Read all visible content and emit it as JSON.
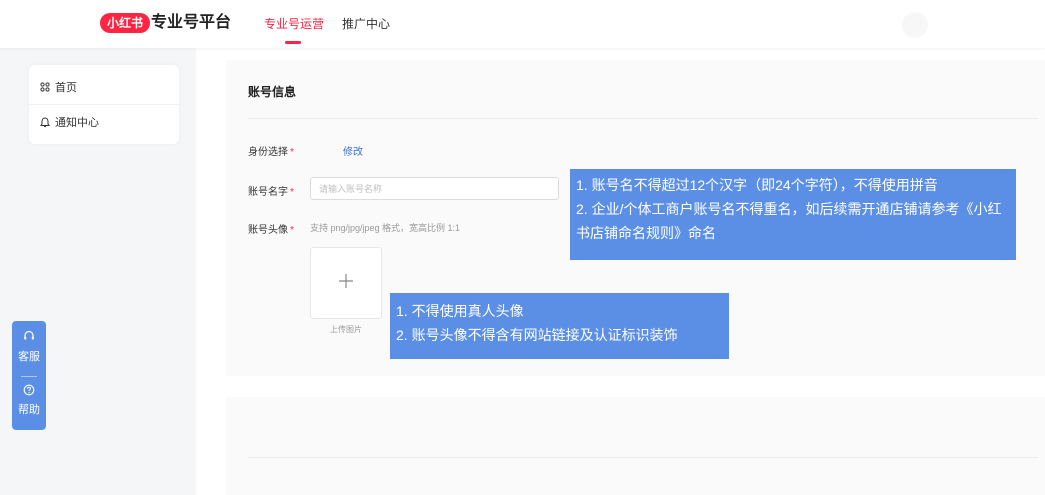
{
  "header": {
    "logo_text": "小红书",
    "platform_title": "专业号平台",
    "tabs": [
      {
        "label": "专业号运营",
        "active": true
      },
      {
        "label": "推广中心",
        "active": false
      }
    ]
  },
  "sidebar": {
    "items": [
      {
        "label": "首页",
        "icon": "grid-icon"
      },
      {
        "label": "通知中心",
        "icon": "bell-icon"
      }
    ]
  },
  "float_support": {
    "service_label": "客服",
    "help_label": "帮助"
  },
  "account_info": {
    "title": "账号信息",
    "identity": {
      "label": "身份选择",
      "required_mark": "*",
      "edit_label": "修改"
    },
    "name": {
      "label": "账号名字",
      "required_mark": "*",
      "placeholder": "请输入账号名称",
      "value": ""
    },
    "avatar": {
      "label": "账号头像",
      "required_mark": "*",
      "hint": "支持 png/jpg/jpeg 格式，宽高比例 1:1",
      "upload_label": "上传图片"
    }
  },
  "tips": {
    "name_rules": [
      "1. 账号名不得超过12个汉字（即24个字符），不得使用拼音",
      "2. 企业/个体工商户账号名不得重名，如后续需开通店铺请参考《小红书店铺命名规则》命名"
    ],
    "avatar_rules": [
      "1. 不得使用真人头像",
      "2. 账号头像不得含有网站链接及认证标识装饰"
    ]
  },
  "colors": {
    "brand": "#ff2442",
    "tip_bg": "#5b8fe6",
    "link": "#3d6fd8"
  }
}
